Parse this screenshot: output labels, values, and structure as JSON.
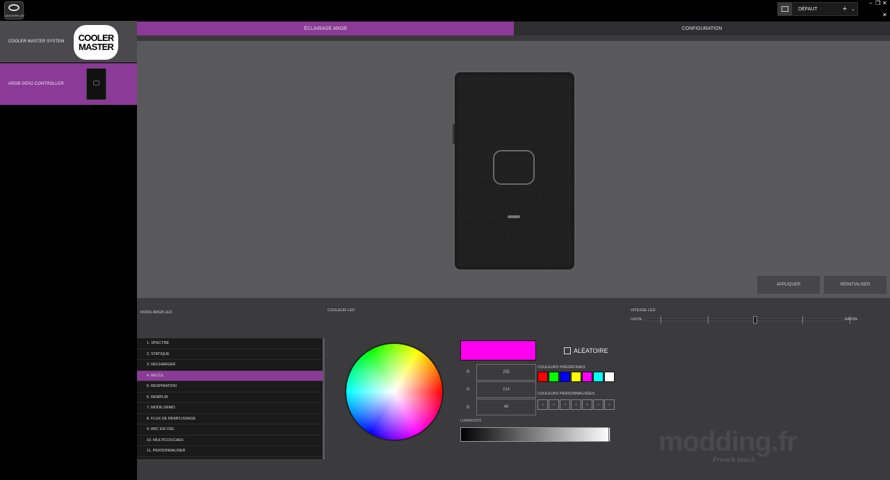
{
  "titlebar": {
    "app_logo_text": "MASTERPLUS+",
    "profile_name": "DÉFAUT",
    "add_symbol": "+",
    "dropdown_symbol": "⌄",
    "minimize_symbol": "–",
    "restore_symbol": "❐",
    "close_symbol": "✕",
    "tools_symbol": "✕"
  },
  "sidebar": {
    "items": [
      {
        "label": "COOLER MASTER SYSTEM",
        "logo_line1": "COOLER",
        "logo_line2": "MASTER"
      },
      {
        "label": "ARGB GEN2 CONTROLLER"
      }
    ]
  },
  "tabs": [
    {
      "label": "ÉCLAIRAGE ARGB",
      "active": true
    },
    {
      "label": "CONFIGURATION",
      "active": false
    }
  ],
  "preview": {
    "apply_label": "APPLIQUER",
    "reset_label": "RÉINITIALISER"
  },
  "controls": {
    "mode_label": "MODE ARGB LED",
    "color_label": "COULEUR LED",
    "speed_label": "VITESSE LED",
    "speed_min_label": "LENTE",
    "speed_max_label": "RAPIDE",
    "speed_level": 3,
    "speed_steps": 5,
    "modes": [
      "1. SPECTRE",
      "2. STATIQUE",
      "3. RECHARGER",
      "4. RECUL",
      "5. RESPIRATION",
      "6. REMPLIR",
      "7. MODE DÉMO",
      "8. FLUX DE REMPLISSAGE",
      "9. ARC EN CIEL",
      "10. MULTICOUCHES",
      "11. PERSONNALISER"
    ],
    "selected_mode_index": 3,
    "current_color": "#ff00f0",
    "r_label": "R",
    "g_label": "G",
    "b_label": "B",
    "r_value": "255",
    "g_value": "214",
    "b_value": "48",
    "random_label": "ALÉATOIRE",
    "random_checked": false,
    "preset_label": "COULEURS PRÉDÉFINIES",
    "preset_colors": [
      "#ff0000",
      "#00ff00",
      "#0000ff",
      "#ffff00",
      "#ff00ff",
      "#00ffff",
      "#ffffff"
    ],
    "custom_label": "COULEURS PERSONNALISÉES",
    "custom_slot_symbol": "+",
    "custom_slot_count": 7,
    "brightness_label": "LUMINOSITÉ",
    "brightness_value": 1.0
  },
  "watermark": {
    "main": "modding.fr",
    "sub": "French touch"
  },
  "colors": {
    "accent": "#8b3a98"
  }
}
